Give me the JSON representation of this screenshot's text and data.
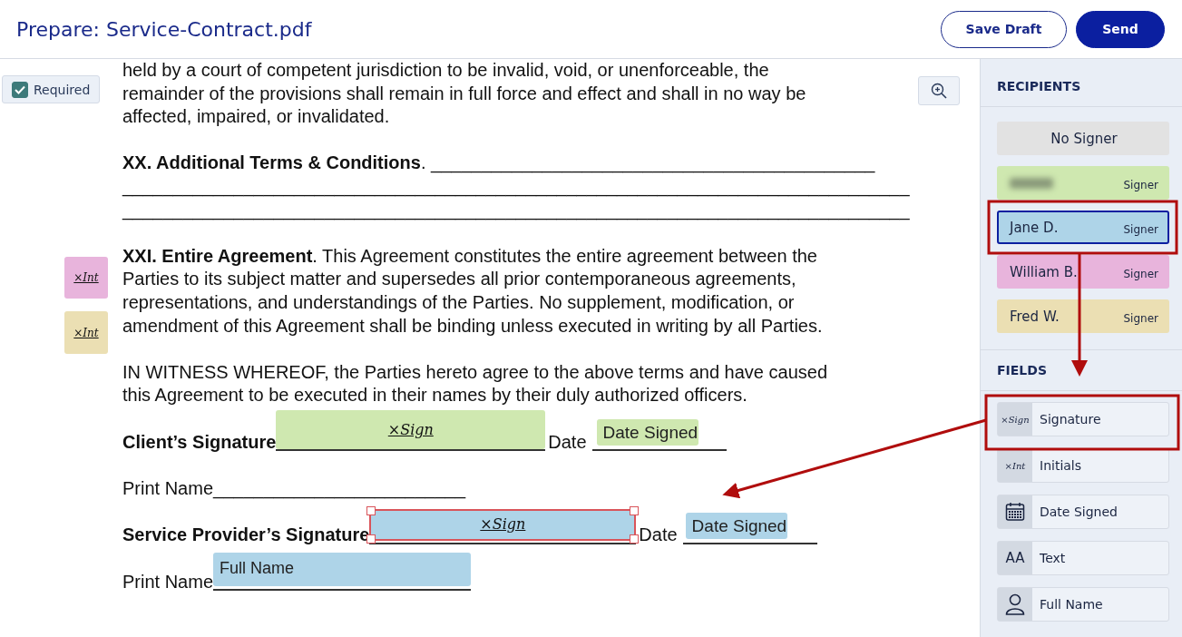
{
  "header": {
    "title": "Prepare: Service-Contract.pdf",
    "buttons": [
      {
        "label": "Save Draft",
        "kind": "secondary"
      },
      {
        "label": "Send",
        "kind": "primary"
      }
    ]
  },
  "required_toggle": {
    "label": "Required",
    "checked": true
  },
  "document": {
    "paragraphs": [
      {
        "kind": "text",
        "text": "held by a court of competent jurisdiction to be invalid, void, or unenforceable, the remainder of the provisions shall remain in full force and effect and shall in no way be affected, impaired, or invalidated."
      },
      {
        "kind": "lines",
        "lines": [
          "**XX. Additional Terms & Conditions**. ____________________________________________",
          "______________________________________________________________________________",
          "______________________________________________________________________________"
        ]
      },
      {
        "kind": "text",
        "text": "**XXI. Entire Agreement**. This Agreement constitutes the entire agreement between the Parties to its subject matter and supersedes all prior contemporaneous agreements, representations, and understandings of the Parties. No supplement, modification, or amendment of this Agreement shall be binding unless executed in writing by all Parties."
      },
      {
        "kind": "text",
        "text": "IN WITNESS WHEREOF, the Parties hereto agree to the above terms and have caused this Agreement to be executed in their names by their duly authorized officers."
      }
    ],
    "signature_rows": [
      {
        "label": "Client’s Signature",
        "bold": true,
        "line_field": {
          "kind": "signature",
          "text": "×Sign",
          "color": "#cfe8b0",
          "selected": false
        },
        "date_label": "Date",
        "date_field": {
          "kind": "date",
          "text": "Date Signed",
          "color": "#cfe8b0",
          "selected": false
        }
      },
      {
        "label": "Print Name",
        "bold": false,
        "line": "_________________________"
      },
      {
        "label": "Service Provider’s Signature",
        "bold": true,
        "line_field": {
          "kind": "signature",
          "text": "×Sign",
          "color": "#aed4e8",
          "selected": true
        },
        "date_label": "Date",
        "date_field": {
          "kind": "date",
          "text": "Date Signed",
          "color": "#aed4e8",
          "selected": false
        }
      },
      {
        "label": "Print Name",
        "bold": false,
        "line_field": {
          "kind": "name",
          "text": "Full Name",
          "color": "#aed4e8",
          "selected": false
        }
      }
    ],
    "placed_fields": [
      {
        "kind": "initials",
        "text": "×Int",
        "color": "#e8b4dc",
        "selected": false
      },
      {
        "kind": "initials",
        "text": "×Int",
        "color": "#ebdfb3",
        "selected": false
      }
    ]
  },
  "sidebar": {
    "recipients_heading": "RECIPIENTS",
    "recipients": [
      {
        "kind": "none",
        "name": "No Signer",
        "color": "#e2e2e2",
        "selected": false
      },
      {
        "kind": "redacted",
        "role": "Signer",
        "color": "#cfe8b0",
        "selected": false
      },
      {
        "kind": "signer",
        "name": "Jane D.",
        "role": "Signer",
        "color": "#aed4e8",
        "selected": true
      },
      {
        "kind": "signer",
        "name": "William B.",
        "role": "Signer",
        "color": "#e8b4dc",
        "selected": false
      },
      {
        "kind": "signer",
        "name": "Fred W.",
        "role": "Signer",
        "color": "#ebdfb3",
        "selected": false
      }
    ],
    "fields_heading": "FIELDS",
    "fields": [
      {
        "kind": "signature",
        "label": "Signature",
        "icon_text": "×Sign"
      },
      {
        "kind": "initials",
        "label": "Initials",
        "icon_text": "×Int"
      },
      {
        "kind": "date",
        "label": "Date Signed"
      },
      {
        "kind": "text",
        "label": "Text",
        "icon_text": "AA"
      },
      {
        "kind": "name",
        "label": "Full Name"
      }
    ]
  }
}
